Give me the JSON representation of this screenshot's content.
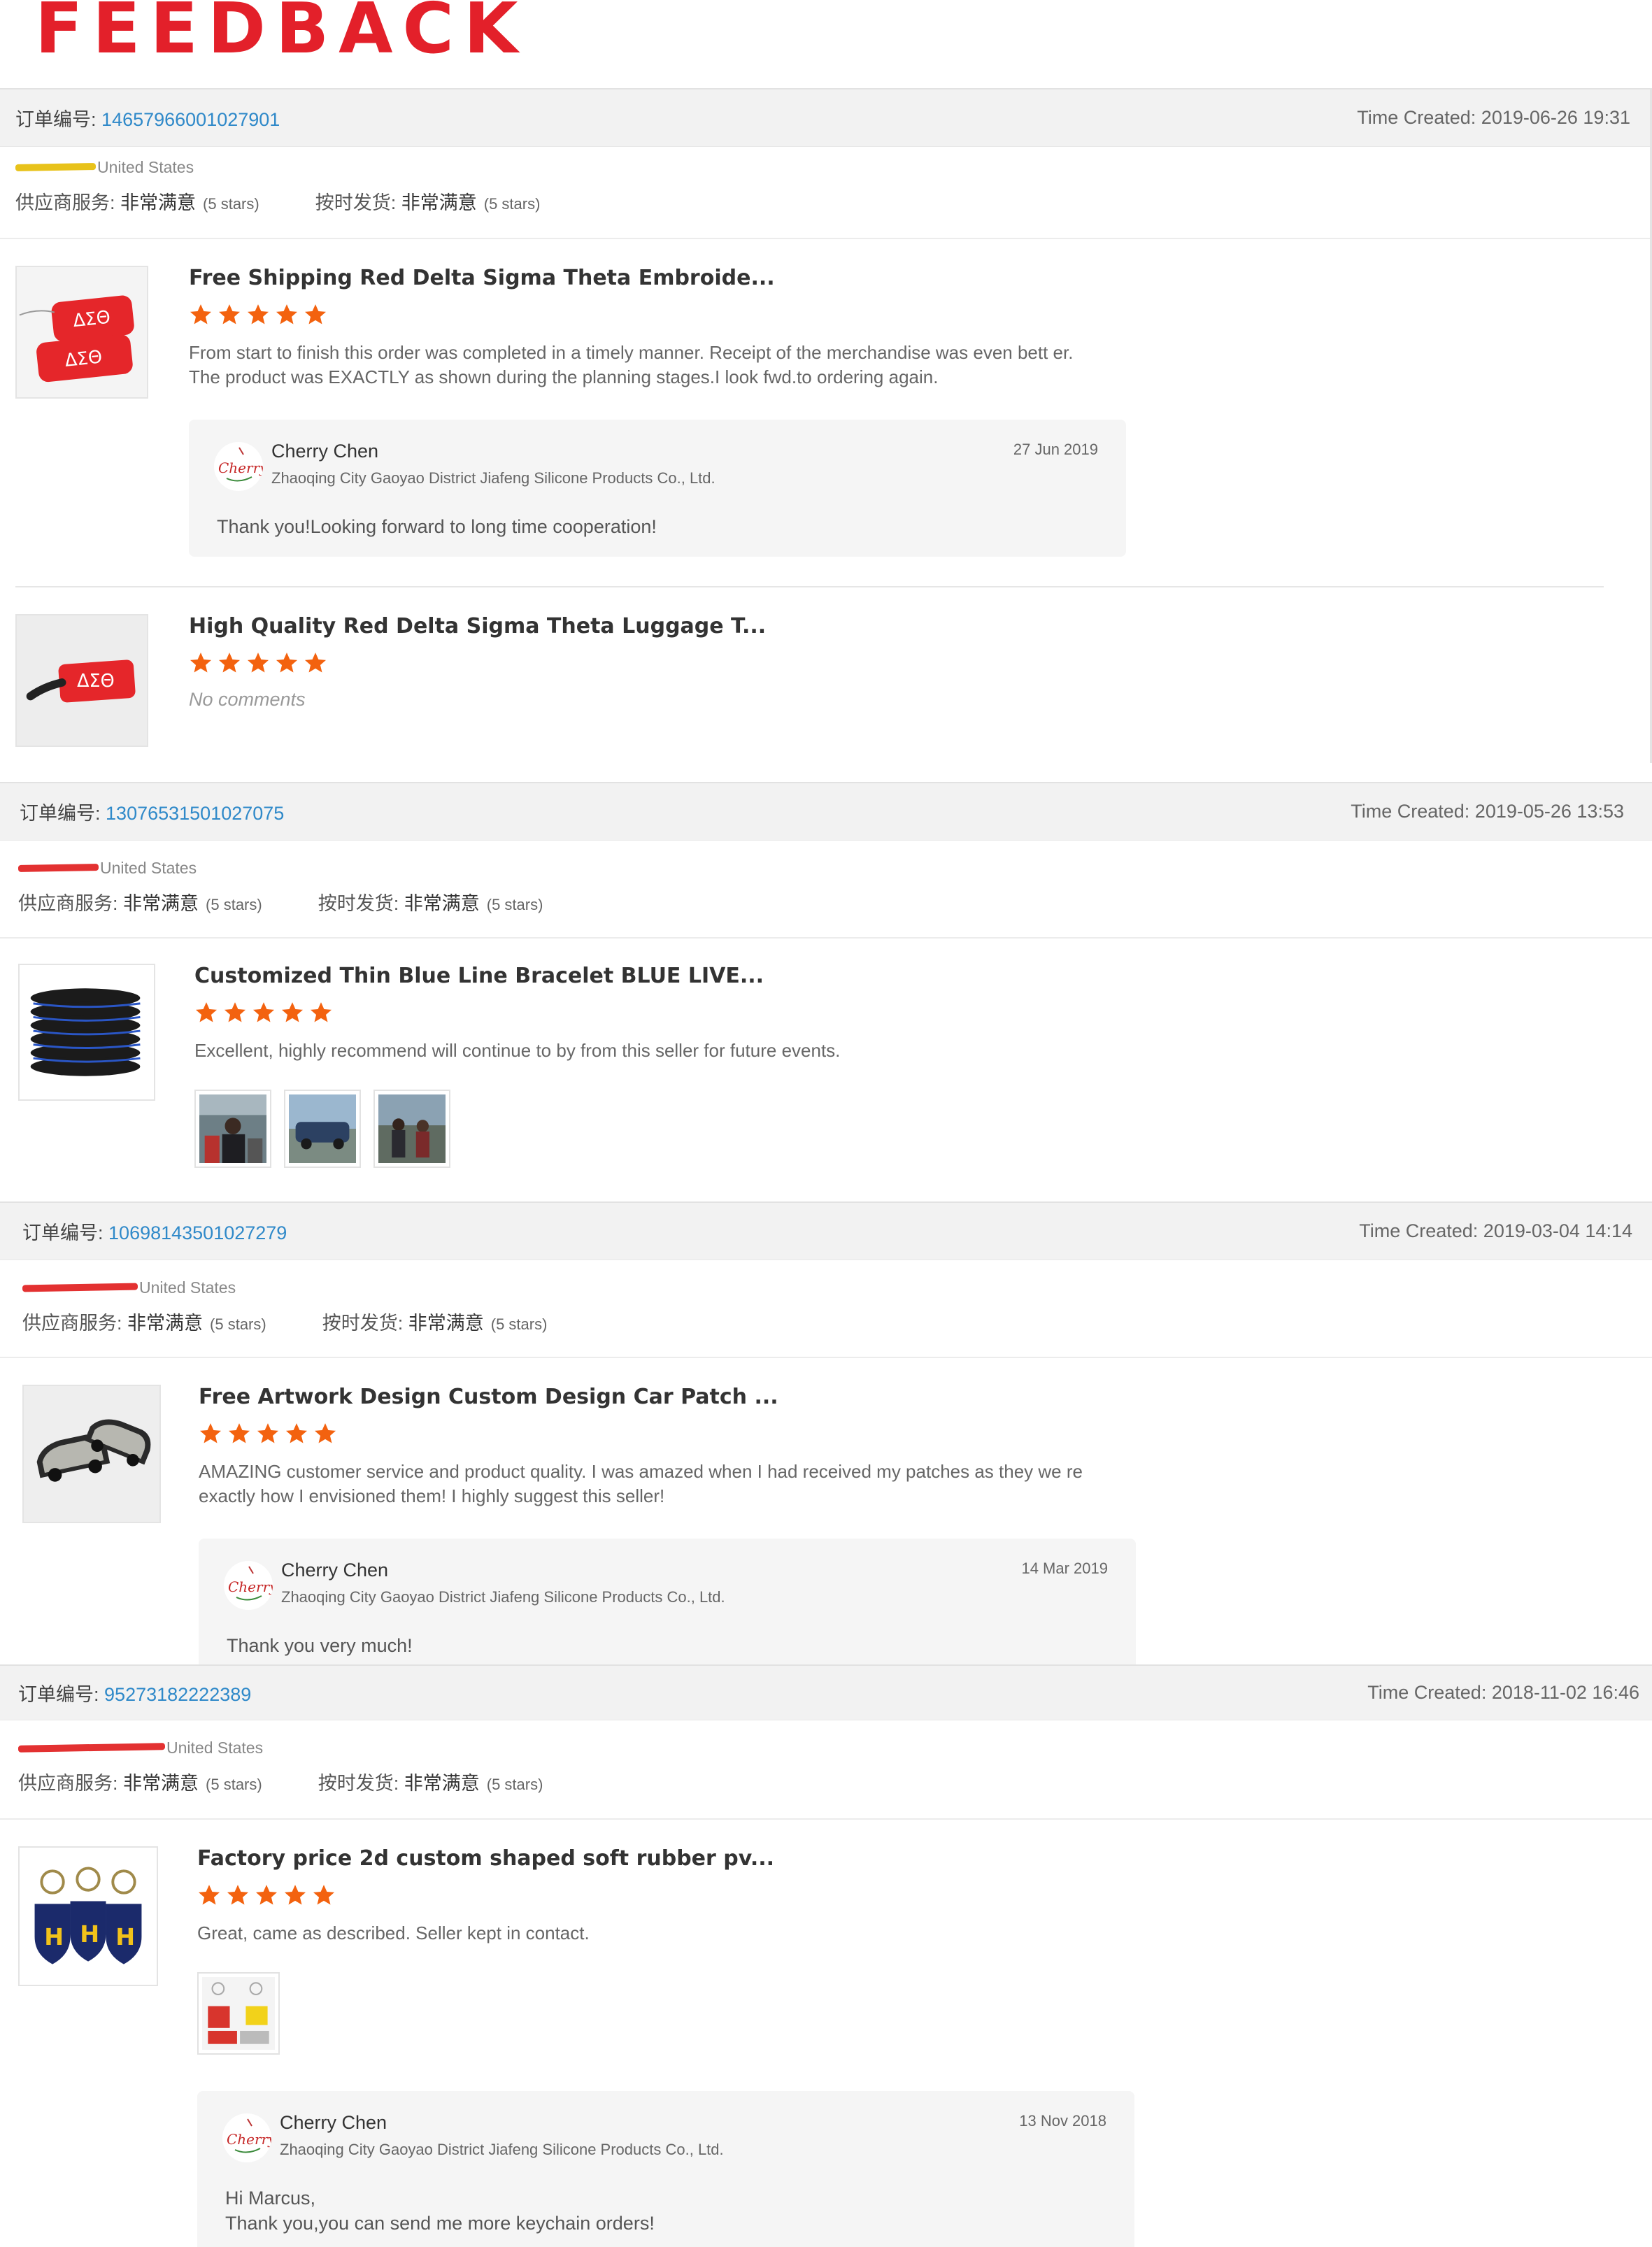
{
  "page_title": "FEEDBACK",
  "colors": {
    "accent": "#e3202a",
    "link": "#2f89c9",
    "star": "#f3620f"
  },
  "orders": [
    {
      "order_label": "订单编号:",
      "order_no": "14657966001027901",
      "time_created": "Time Created: 2019-06-26 19:31",
      "buyer_country": "United States",
      "ratings": {
        "supplier_label": "供应商服务:",
        "supplier_value": "非常满意",
        "supplier_stars": "(5 stars)",
        "shipping_label": "按时发货:",
        "shipping_value": "非常满意",
        "shipping_stars": "(5 stars)"
      },
      "items": [
        {
          "title": "Free Shipping Red Delta Sigma Theta Embroide...",
          "stars": 5,
          "review": "From start to finish this order was completed in a timely manner. Receipt of the merchandise was even bett er. The product was EXACTLY as shown during the planning stages.I look fwd.to ordering again.",
          "reply": {
            "name": "Cherry Chen",
            "company": "Zhaoqing City Gaoyao District Jiafeng Silicone Products Co., Ltd.",
            "date": "27 Jun 2019",
            "text": "Thank you!Looking forward to long time cooperation!"
          }
        },
        {
          "title": "High Quality Red Delta Sigma Theta Luggage T...",
          "stars": 5,
          "no_comments": "No comments"
        }
      ]
    },
    {
      "order_label": "订单编号:",
      "order_no": "13076531501027075",
      "time_created": "Time Created: 2019-05-26 13:53",
      "buyer_country": "United States",
      "ratings": {
        "supplier_label": "供应商服务:",
        "supplier_value": "非常满意",
        "supplier_stars": "(5 stars)",
        "shipping_label": "按时发货:",
        "shipping_value": "非常满意",
        "shipping_stars": "(5 stars)"
      },
      "items": [
        {
          "title": "Customized Thin Blue Line Bracelet BLUE LIVE...",
          "stars": 5,
          "review": "Excellent, highly recommend will continue to by from this seller for future events."
        }
      ]
    },
    {
      "order_label": "订单编号:",
      "order_no": "10698143501027279",
      "time_created": "Time Created: 2019-03-04 14:14",
      "buyer_country": "United States",
      "ratings": {
        "supplier_label": "供应商服务:",
        "supplier_value": "非常满意",
        "supplier_stars": "(5 stars)",
        "shipping_label": "按时发货:",
        "shipping_value": "非常满意",
        "shipping_stars": "(5 stars)"
      },
      "items": [
        {
          "title": "Free Artwork Design Custom Design Car Patch ...",
          "stars": 5,
          "review": "AMAZING customer service and product quality. I was amazed when I had received my patches as they we re exactly how I envisioned them! I highly suggest this seller!",
          "reply": {
            "name": "Cherry Chen",
            "company": "Zhaoqing City Gaoyao District Jiafeng Silicone Products Co., Ltd.",
            "date": "14 Mar 2019",
            "text": "Thank you very much!"
          }
        }
      ]
    },
    {
      "order_label": "订单编号:",
      "order_no": "95273182222389",
      "time_created": "Time Created: 2018-11-02 16:46",
      "buyer_country": "United States",
      "ratings": {
        "supplier_label": "供应商服务:",
        "supplier_value": "非常满意",
        "supplier_stars": "(5 stars)",
        "shipping_label": "按时发货:",
        "shipping_value": "非常满意",
        "shipping_stars": "(5 stars)"
      },
      "items": [
        {
          "title": "Factory price 2d custom shaped soft rubber pv...",
          "stars": 5,
          "review": "Great, came as described. Seller kept in contact.",
          "reply": {
            "name": "Cherry Chen",
            "company": "Zhaoqing City Gaoyao District Jiafeng Silicone Products Co., Ltd.",
            "date": "13 Nov 2018",
            "text_line1": "Hi Marcus,",
            "text_line2": "Thank you,you can send me more keychain orders!"
          }
        }
      ]
    }
  ]
}
